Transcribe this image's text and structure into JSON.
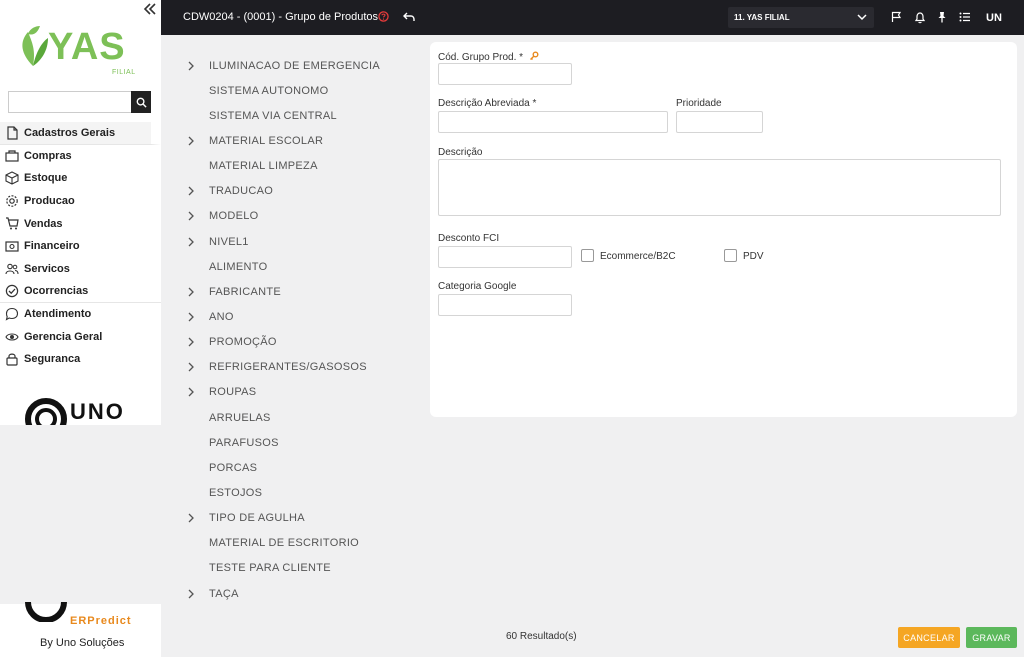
{
  "sidebar": {
    "logo_text": "YAS",
    "logo_sub": "FILIAL",
    "search": {
      "value": "",
      "placeholder": ""
    },
    "menu": [
      {
        "label": "Cadastros Gerais",
        "icon": "file-icon"
      },
      {
        "label": "Compras",
        "icon": "bag-icon"
      },
      {
        "label": "Estoque",
        "icon": "box-icon"
      },
      {
        "label": "Producao",
        "icon": "gear-icon"
      },
      {
        "label": "Vendas",
        "icon": "cart-icon"
      },
      {
        "label": "Financeiro",
        "icon": "money-icon"
      },
      {
        "label": "Servicos",
        "icon": "users-icon"
      },
      {
        "label": "Ocorrencias",
        "icon": "check-circle-icon"
      },
      {
        "label": "Atendimento",
        "icon": "chat-icon"
      },
      {
        "label": "Gerencia Geral",
        "icon": "eye-icon"
      },
      {
        "label": "Seguranca",
        "icon": "lock-icon"
      }
    ],
    "uno_logo": "UNO",
    "erp_logo": "ERPredict",
    "footer_text": "By Uno Soluções"
  },
  "header": {
    "title": "CDW0204 - (0001) - Grupo de Produtos",
    "branch_select": "11. YAS FILIAL",
    "user_initials": "UN"
  },
  "tree": [
    {
      "label": "ILUMINACAO DE EMERGENCIA",
      "expandable": true
    },
    {
      "label": "SISTEMA AUTONOMO",
      "expandable": false
    },
    {
      "label": "SISTEMA VIA CENTRAL",
      "expandable": false
    },
    {
      "label": "MATERIAL ESCOLAR",
      "expandable": true
    },
    {
      "label": "MATERIAL LIMPEZA",
      "expandable": false
    },
    {
      "label": "TRADUCAO",
      "expandable": true
    },
    {
      "label": "MODELO",
      "expandable": true
    },
    {
      "label": "NIVEL1",
      "expandable": true
    },
    {
      "label": "ALIMENTO",
      "expandable": false
    },
    {
      "label": "FABRICANTE",
      "expandable": true
    },
    {
      "label": "ANO",
      "expandable": true
    },
    {
      "label": "PROMOÇÃO",
      "expandable": true
    },
    {
      "label": "REFRIGERANTES/GASOSOS",
      "expandable": true
    },
    {
      "label": "ROUPAS",
      "expandable": true
    },
    {
      "label": "ARRUELAS",
      "expandable": false
    },
    {
      "label": "PARAFUSOS",
      "expandable": false
    },
    {
      "label": "PORCAS",
      "expandable": false
    },
    {
      "label": "ESTOJOS",
      "expandable": false
    },
    {
      "label": "TIPO DE AGULHA",
      "expandable": true
    },
    {
      "label": "MATERIAL DE ESCRITORIO",
      "expandable": false
    },
    {
      "label": "TESTE PARA CLIENTE",
      "expandable": false
    },
    {
      "label": "TAÇA",
      "expandable": true
    }
  ],
  "form": {
    "cod_label": "Cód. Grupo Prod. *",
    "cod_value": "",
    "desc_abrev_label": "Descrição Abreviada *",
    "desc_abrev_value": "",
    "prioridade_label": "Prioridade",
    "prioridade_value": "",
    "descricao_label": "Descrição",
    "descricao_value": "",
    "desconto_label": "Desconto FCI",
    "desconto_value": "",
    "ecommerce_label": "Ecommerce/B2C",
    "pdv_label": "PDV",
    "categoria_label": "Categoria Google",
    "categoria_value": ""
  },
  "footer": {
    "results": "60 Resultado(s)",
    "cancel_label": "CANCELAR",
    "save_label": "GRAVAR"
  },
  "colors": {
    "header_bg": "#1d1d22",
    "brand_green": "#7dc057",
    "cancel": "#f5a623",
    "save": "#5cb85c"
  }
}
